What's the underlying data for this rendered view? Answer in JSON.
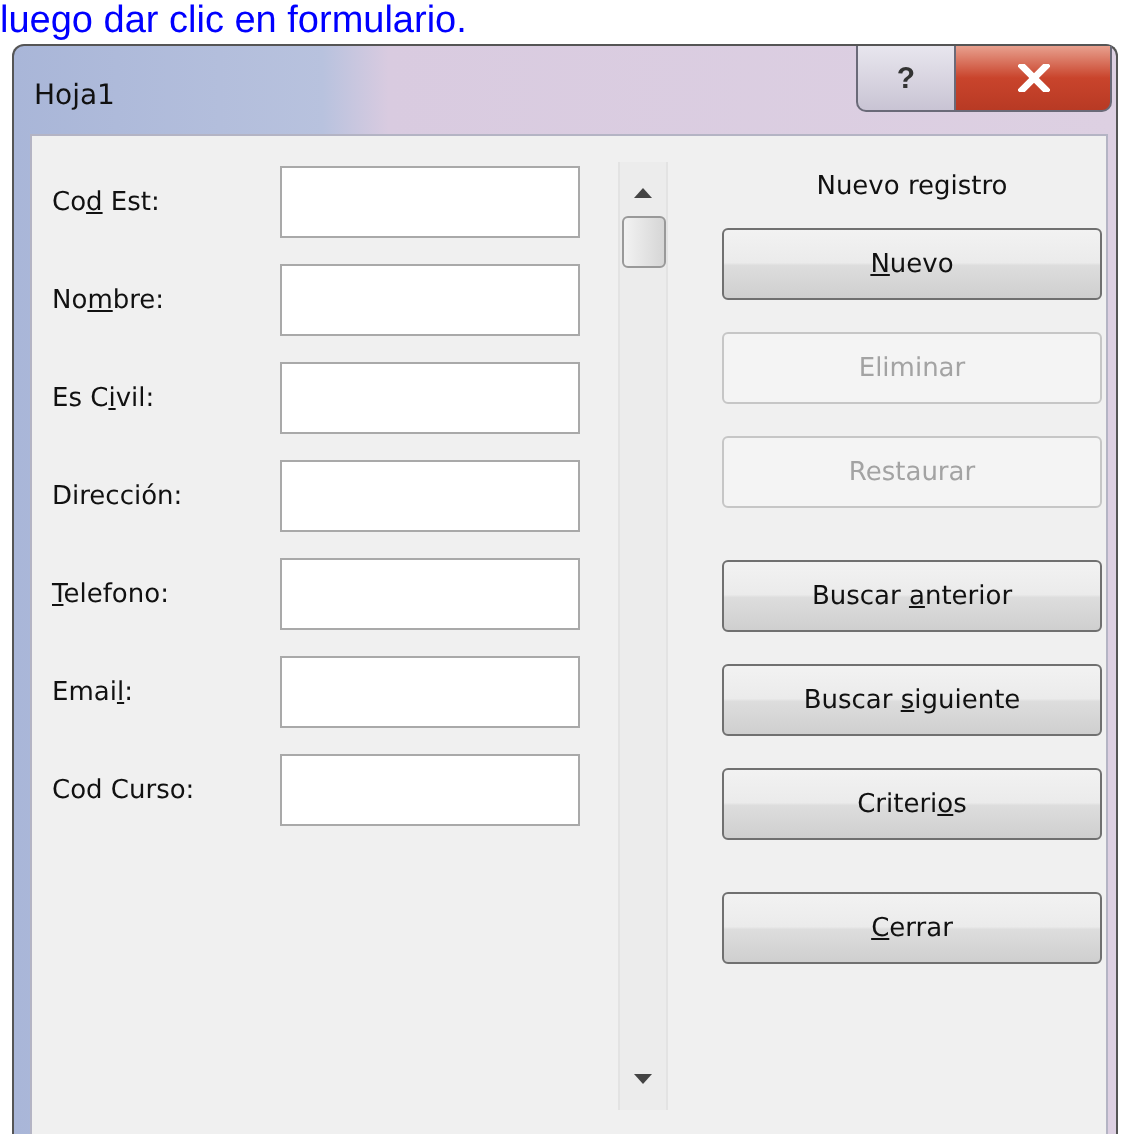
{
  "caption": "luego dar clic en formulario.",
  "window": {
    "title": "Hoja1",
    "help_button": "?"
  },
  "fields": [
    {
      "label": {
        "before": "Co",
        "key": "d",
        "after": " Est:"
      }
    },
    {
      "label": {
        "before": "No",
        "key": "m",
        "after": "bre:"
      }
    },
    {
      "label": {
        "before": "Es C",
        "key": "i",
        "after": "vil:"
      }
    },
    {
      "label": {
        "before": "Dirección:"
      }
    },
    {
      "label": {
        "key": "T",
        "after": "elefono:"
      }
    },
    {
      "label": {
        "before": "Emai",
        "key": "l",
        "after": ":"
      }
    },
    {
      "label": {
        "before": "Cod Curso:"
      }
    }
  ],
  "record_status": "Nuevo registro",
  "button_groups": [
    [
      {
        "label": {
          "key": "N",
          "after": "uevo"
        },
        "disabled": false
      },
      {
        "label": {
          "before": "Eliminar"
        },
        "disabled": true
      },
      {
        "label": {
          "before": "Restaurar"
        },
        "disabled": true
      }
    ],
    [
      {
        "label": {
          "before": "Buscar ",
          "key": "a",
          "after": "nterior"
        },
        "disabled": false
      },
      {
        "label": {
          "before": "Buscar ",
          "key": "s",
          "after": "iguiente"
        },
        "disabled": false
      },
      {
        "label": {
          "before": "Criteri",
          "key": "o",
          "after": "s"
        },
        "disabled": false
      }
    ],
    [
      {
        "label": {
          "key": "C",
          "after": "errar"
        },
        "disabled": false
      }
    ]
  ]
}
